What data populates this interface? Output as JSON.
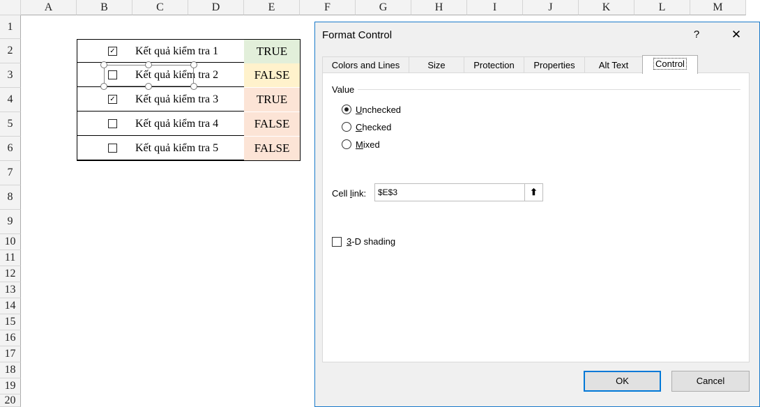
{
  "sheet": {
    "columns": [
      "A",
      "B",
      "C",
      "D",
      "E",
      "F",
      "G",
      "H",
      "I",
      "J",
      "K",
      "L",
      "M"
    ],
    "rows": [
      "1",
      "2",
      "3",
      "4",
      "5",
      "6",
      "7",
      "8",
      "9",
      "10",
      "11",
      "12",
      "13",
      "14",
      "15",
      "16",
      "17",
      "18",
      "19",
      "20"
    ],
    "table": [
      {
        "checked": true,
        "check_glyph": "✓",
        "label": "Kết quả kiểm tra 1",
        "value": "TRUE",
        "color": "#e2efda"
      },
      {
        "checked": false,
        "check_glyph": "",
        "label": "Kết quả kiểm tra 2",
        "value": "FALSE",
        "color": "#fff2cc"
      },
      {
        "checked": true,
        "check_glyph": "✓",
        "label": "Kết quả kiểm tra 3",
        "value": "TRUE",
        "color": "#fce4d6"
      },
      {
        "checked": false,
        "check_glyph": "",
        "label": "Kết quả kiểm tra 4",
        "value": "FALSE",
        "color": "#fce4d6"
      },
      {
        "checked": false,
        "check_glyph": "",
        "label": "Kết quả kiểm tra 5",
        "value": "FALSE",
        "color": "#fce4d6"
      }
    ]
  },
  "dialog": {
    "title": "Format Control",
    "help_glyph": "?",
    "close_glyph": "✕",
    "tabs": [
      {
        "label": "Colors and Lines",
        "active": false
      },
      {
        "label": "Size",
        "active": false
      },
      {
        "label": "Protection",
        "active": false
      },
      {
        "label": "Properties",
        "active": false
      },
      {
        "label": "Alt Text",
        "active": false
      },
      {
        "label": "Control",
        "active": true
      }
    ],
    "value_group_label": "Value",
    "radios": [
      {
        "key": "U",
        "rest": "nchecked",
        "selected": true
      },
      {
        "key": "C",
        "rest": "hecked",
        "selected": false
      },
      {
        "key": "M",
        "rest": "ixed",
        "selected": false
      }
    ],
    "cell_link_label_pre": "Cell ",
    "cell_link_label_key": "l",
    "cell_link_label_post": "ink:",
    "cell_link_value": "$E$3",
    "cell_link_button_glyph": "⬆",
    "shading_key": "3",
    "shading_rest": "-D shading",
    "shading_checked": false,
    "ok_label": "OK",
    "cancel_label": "Cancel"
  }
}
